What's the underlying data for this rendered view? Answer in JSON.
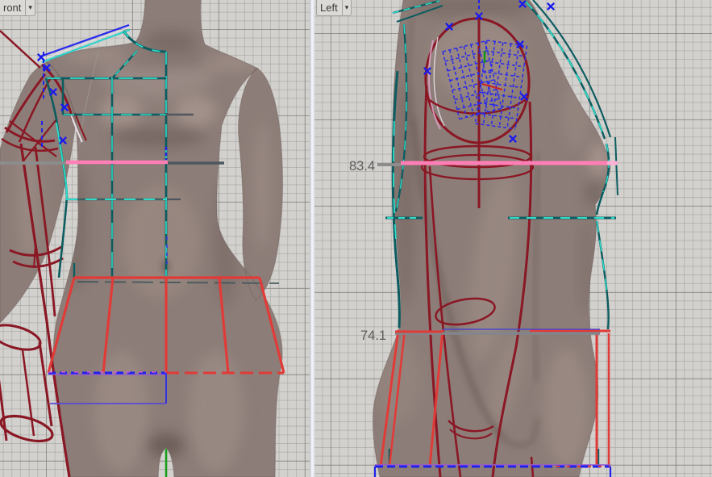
{
  "workspace": {
    "viewports": [
      {
        "label": "ront",
        "dropdown_icon": "▾"
      },
      {
        "label": "Left",
        "dropdown_icon": "▾"
      }
    ]
  },
  "measurements": [
    {
      "value": "83.4"
    },
    {
      "value": "74.1"
    }
  ],
  "colors": {
    "grid_background": "#d3d1ce",
    "grid_minor_line": "#c2c0bd",
    "grid_major_line": "#a5a3a0",
    "viewport_divider": "#eef2f6",
    "mannequin_skin": "#8d7d78",
    "pattern_teal": "#0d5c60",
    "pattern_cyan": "#2bdcc8",
    "pattern_maroon": "#8a1724",
    "pattern_red": "#e13b38",
    "pattern_pink": "#ff7eb6",
    "pattern_blue": "#2121ec",
    "pattern_violet": "#9a5ad0",
    "pattern_green": "#18a018",
    "measure_line_gray": "#8c8c8c",
    "measure_text_gray": "#5c5c5c"
  }
}
